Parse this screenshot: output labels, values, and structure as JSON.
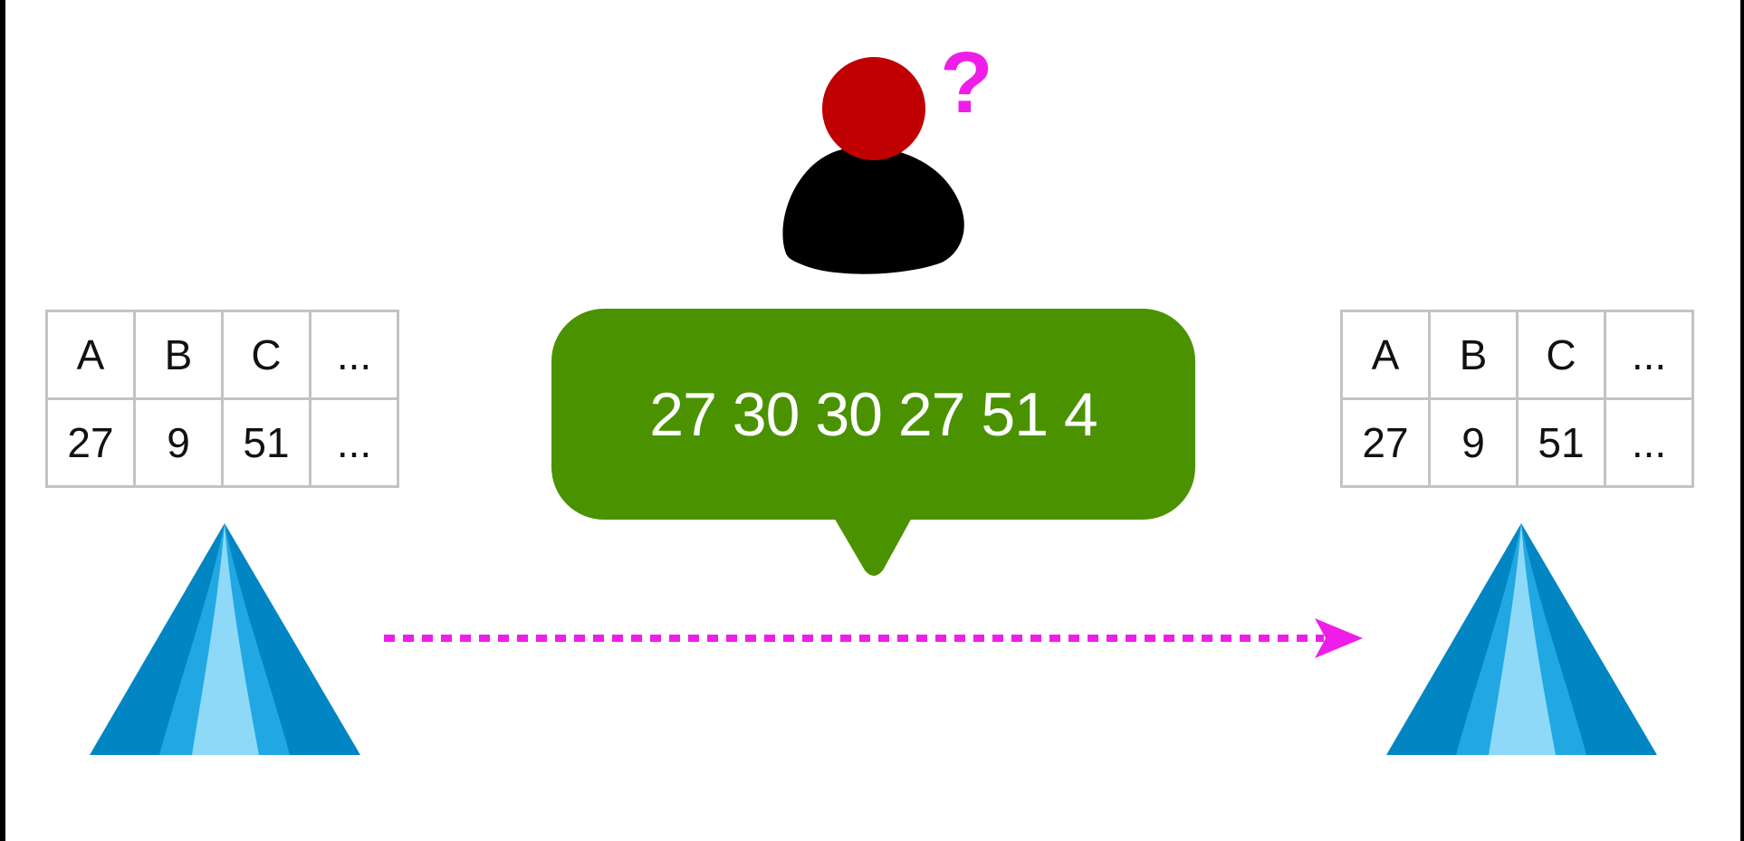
{
  "colors": {
    "person_head": "#c00000",
    "person_body": "#000000",
    "question_mark": "#ee1ee8",
    "bubble": "#4a9200",
    "bubble_text": "#ffffff",
    "arrow": "#ee1ee8",
    "pyramid_outer": "#0186c3",
    "pyramid_mid": "#21a8e3",
    "pyramid_inner": "#8ed9f8",
    "table_border": "#c3c3c3"
  },
  "person": {
    "question_mark": "?"
  },
  "speech_bubble": {
    "text": "27 30 30 27 51 4"
  },
  "left_table": {
    "header": [
      "A",
      "B",
      "C",
      "..."
    ],
    "row": [
      "27",
      "9",
      "51",
      "..."
    ]
  },
  "right_table": {
    "header": [
      "A",
      "B",
      "C",
      "..."
    ],
    "row": [
      "27",
      "9",
      "51",
      "..."
    ]
  },
  "icons": {
    "left_node": "pyramid-icon",
    "right_node": "pyramid-icon",
    "person": "person-icon",
    "arrow": "dotted-arrow"
  }
}
